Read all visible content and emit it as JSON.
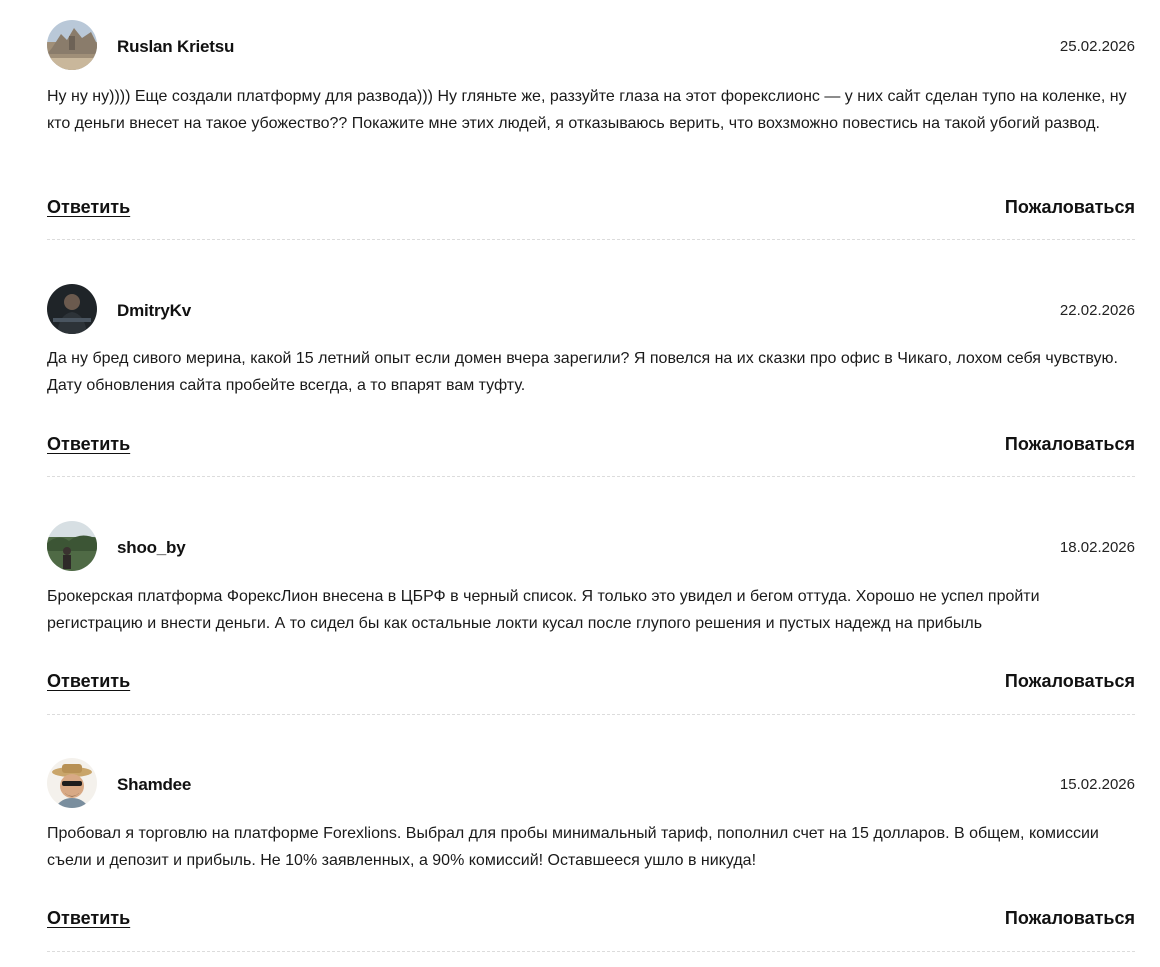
{
  "comments": [
    {
      "author": "Ruslan Krietsu",
      "date": "25.02.2026",
      "text": "Ну ну ну)))) Еще создали платформу для развода))) Ну гляньте же, раззуйте глаза на этот форекслионс — у них сайт сделан тупо на коленке, ну кто деньги внесет на такое убожество?? Покажите мне этих людей, я отказываюсь верить, что вохзможно повестись на такой убогий развод.",
      "reply_label": "Ответить",
      "report_label": "Пожаловаться"
    },
    {
      "author": "DmitryKv",
      "date": "22.02.2026",
      "text": "Да ну бред сивого мерина, какой 15 летний опыт если домен вчера зарегили? Я повелся на их сказки про офис в Чикаго, лохом себя чувствую. Дату обновления сайта пробейте всегда, а то впарят вам туфту.",
      "reply_label": "Ответить",
      "report_label": "Пожаловаться"
    },
    {
      "author": "shoo_by",
      "date": "18.02.2026",
      "text": "Брокерская платформа ФорексЛион внесена в ЦБРФ в черный список. Я только это увидел и бегом оттуда. Хорошо не успел пройти регистрацию и внести деньги. А то сидел бы как остальные локти кусал после глупого решения и пустых надежд на прибыль",
      "reply_label": "Ответить",
      "report_label": "Пожаловаться"
    },
    {
      "author": "Shamdee",
      "date": "15.02.2026",
      "text": "Пробовал я торговлю на платформе Forexlions. Выбрал для пробы минимальный тариф, пополнил счет на 15 долларов. В общем, комиссии съели и депозит и прибыль. Не 10% заявленных, а 90% комиссий! Оставшееся ушло в никуда!",
      "reply_label": "Ответить",
      "report_label": "Пожаловаться"
    }
  ]
}
